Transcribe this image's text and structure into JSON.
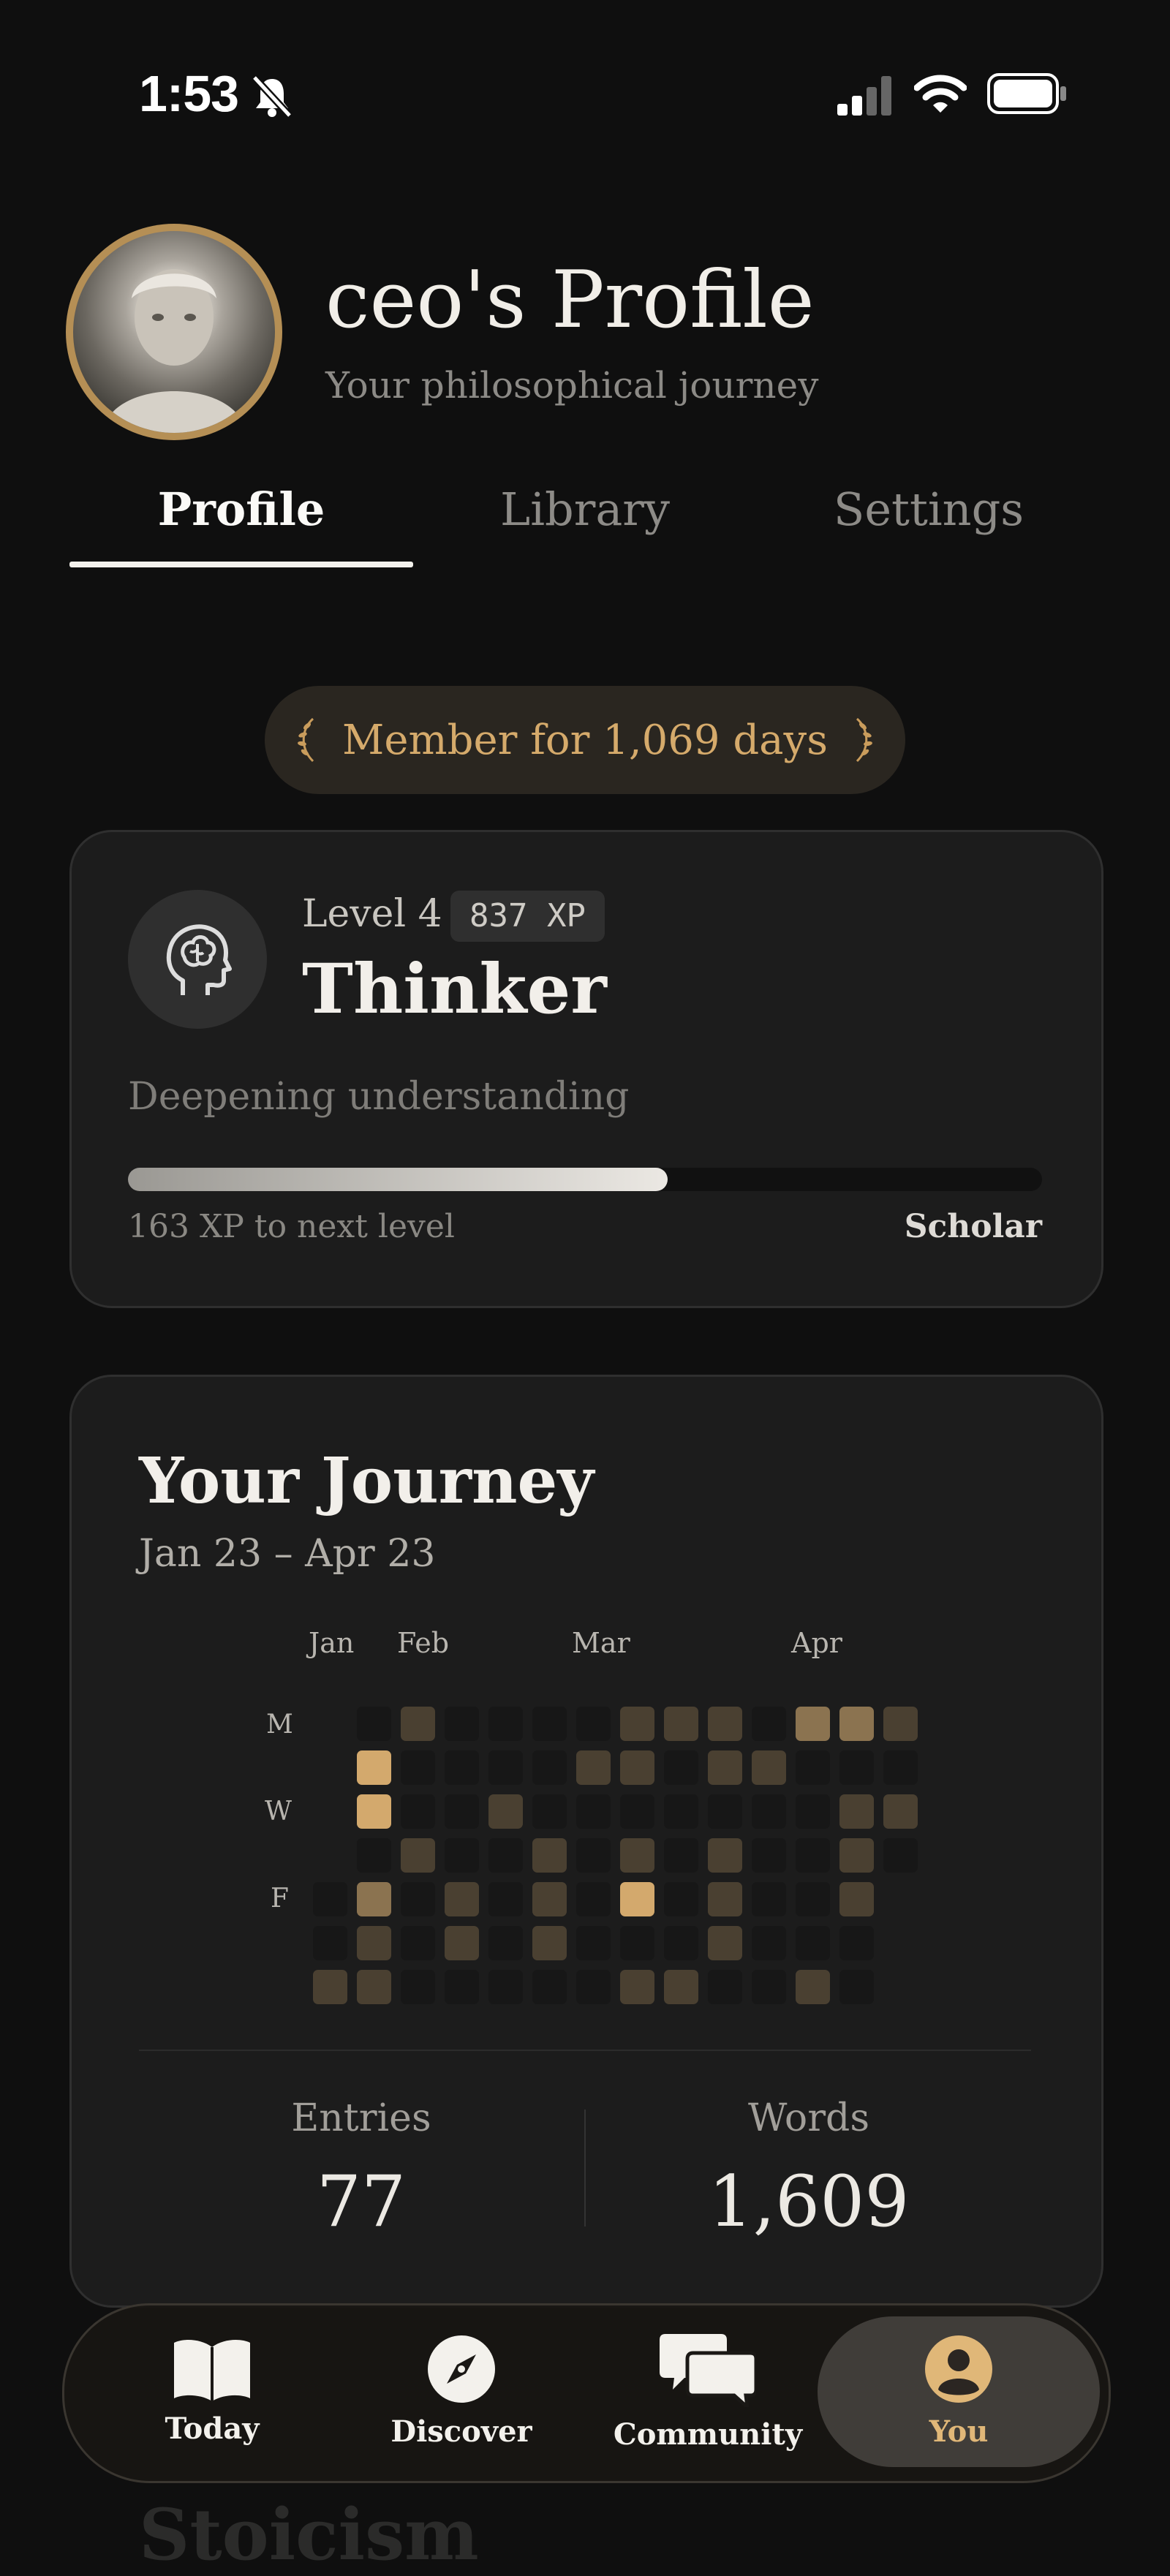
{
  "status_bar": {
    "time": "1:53"
  },
  "header": {
    "title": "ceo's Profile",
    "subtitle": "Your philosophical journey"
  },
  "tabs": [
    {
      "label": "Profile",
      "active": true
    },
    {
      "label": "Library",
      "active": false
    },
    {
      "label": "Settings",
      "active": false
    }
  ],
  "member_badge": {
    "text": "Member for 1,069 days"
  },
  "level": {
    "level_label": "Level 4",
    "xp": "837 XP",
    "rank": "Thinker",
    "description": "Deepening understanding",
    "progress_fraction": 0.59,
    "xp_to_next": "163 XP to next level",
    "next_rank": "Scholar"
  },
  "journey": {
    "title": "Your Journey",
    "range": "Jan 23 – Apr 23",
    "months": [
      "Jan",
      "Feb",
      "Mar",
      "Apr"
    ],
    "day_labels": [
      "M",
      "W",
      "F"
    ],
    "heatmap": [
      [
        null,
        0,
        2,
        0,
        0,
        0,
        0,
        2,
        2,
        2,
        0,
        3,
        3,
        2
      ],
      [
        null,
        4,
        0,
        0,
        0,
        0,
        2,
        2,
        0,
        2,
        2,
        0,
        0,
        0
      ],
      [
        null,
        4,
        0,
        0,
        2,
        0,
        0,
        0,
        0,
        0,
        0,
        0,
        2,
        2
      ],
      [
        null,
        0,
        2,
        0,
        0,
        2,
        0,
        2,
        0,
        2,
        0,
        0,
        2,
        0
      ],
      [
        0,
        3,
        0,
        2,
        0,
        2,
        0,
        4,
        0,
        2,
        0,
        0,
        2,
        null
      ],
      [
        0,
        2,
        0,
        2,
        0,
        2,
        0,
        0,
        0,
        2,
        0,
        0,
        0,
        null
      ],
      [
        2,
        2,
        0,
        0,
        0,
        0,
        0,
        2,
        2,
        0,
        0,
        2,
        0,
        null
      ]
    ],
    "heat_colors": [
      "#171717",
      "#2a2520",
      "#4a4031",
      "#8b7350",
      "#d3a96d"
    ],
    "entries_label": "Entries",
    "entries_value": "77",
    "words_label": "Words",
    "words_value": "1,609"
  },
  "peek_heading": "Stoicism",
  "bottom_nav": [
    {
      "label": "Today",
      "icon": "book-icon",
      "active": false
    },
    {
      "label": "Discover",
      "icon": "compass-icon",
      "active": false
    },
    {
      "label": "Community",
      "icon": "chat-bubbles-icon",
      "active": false
    },
    {
      "label": "You",
      "icon": "person-icon",
      "active": true
    }
  ]
}
